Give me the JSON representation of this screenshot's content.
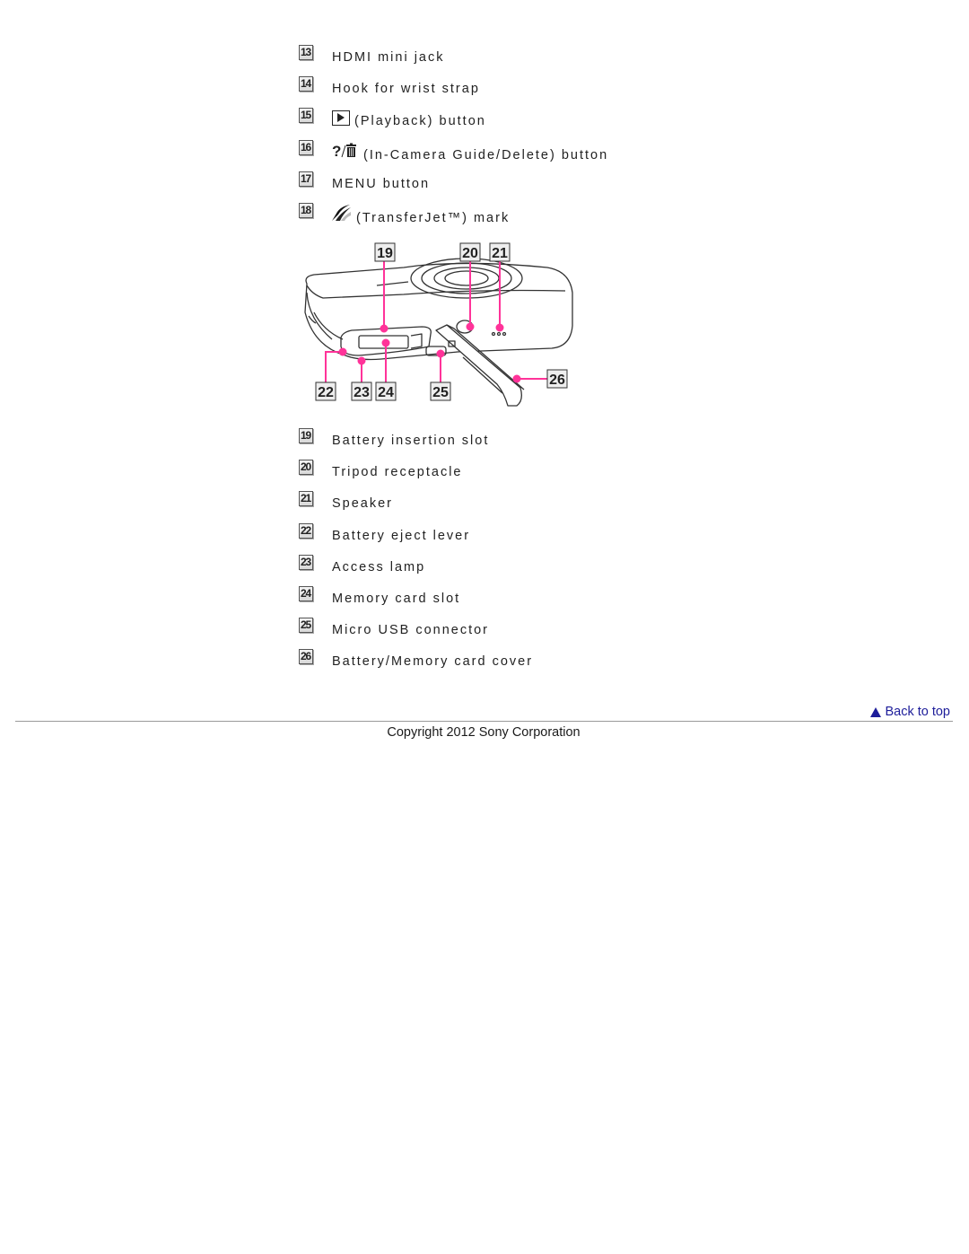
{
  "top_list": [
    {
      "num": "13",
      "label": "HDMI mini jack",
      "icon": null
    },
    {
      "num": "14",
      "label": "Hook for wrist strap",
      "icon": null
    },
    {
      "num": "15",
      "label": "(Playback) button",
      "icon": "playback-icon"
    },
    {
      "num": "16",
      "label": "(In-Camera Guide/Delete) button",
      "icon": "help-delete-icon"
    },
    {
      "num": "17",
      "label": "MENU button",
      "icon": null
    },
    {
      "num": "18",
      "label": "(TransferJet™) mark",
      "icon": "transferjet-icon"
    }
  ],
  "figure": {
    "callouts": [
      "19",
      "20",
      "21",
      "22",
      "23",
      "24",
      "25",
      "26"
    ],
    "leader_color": "#ff3399"
  },
  "bottom_list": [
    {
      "num": "19",
      "label": "Battery insertion slot"
    },
    {
      "num": "20",
      "label": "Tripod receptacle"
    },
    {
      "num": "21",
      "label": "Speaker"
    },
    {
      "num": "22",
      "label": "Battery eject lever"
    },
    {
      "num": "23",
      "label": "Access lamp"
    },
    {
      "num": "24",
      "label": "Memory card slot"
    },
    {
      "num": "25",
      "label": "Micro USB connector"
    },
    {
      "num": "26",
      "label": "Battery/Memory card cover"
    }
  ],
  "footer": {
    "back_to_top": "Back to top",
    "copyright": "Copyright 2012 Sony Corporation",
    "link_color": "#1d1d9a"
  }
}
